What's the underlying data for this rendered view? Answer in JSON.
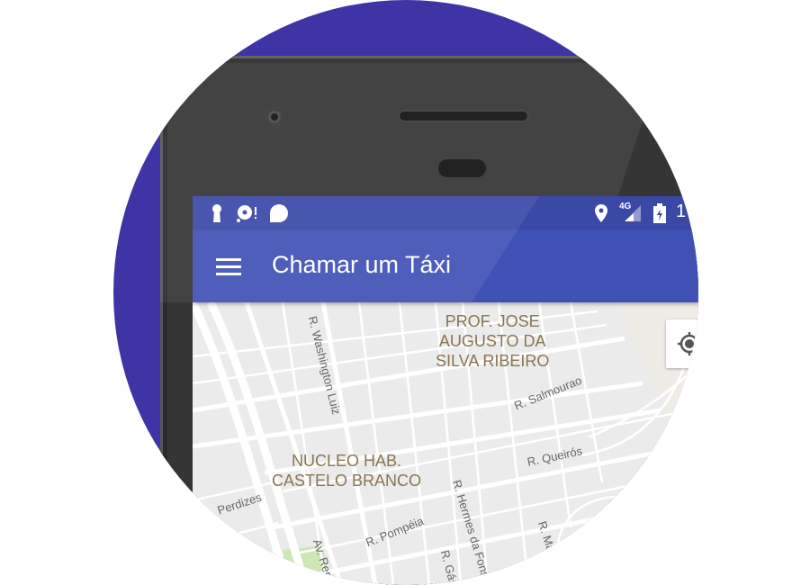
{
  "app": {
    "title": "Chamar um Táxi",
    "menu_icon": "hamburger-menu-icon"
  },
  "status_bar": {
    "left_icons": [
      "keyhole-icon",
      "media-alert-icon",
      "chat-bubble-icon"
    ],
    "right_icons": [
      "location-pin-icon",
      "signal-4g-icon",
      "battery-charging-icon"
    ],
    "network_label": "4G",
    "clock_partial": "1"
  },
  "map": {
    "areas": [
      "PROF. JOSE\nAUGUSTO DA\nSILVA RIBEIRO",
      "NUCLEO HAB.\nCASTELO BRANCO"
    ],
    "streets": [
      "R. Washington Luiz",
      "R. Salmourao",
      "R. Queirós",
      "R. Hermes da Fons",
      "R. Mar",
      "R. Pompéia",
      "R. Gás",
      "Av. Repú",
      "Perdizes"
    ],
    "locate_button_icon": "my-location-icon"
  },
  "colors": {
    "background_circle": "#3f34a5",
    "app_bar": "#3f51b5",
    "status_bar": "#3a48a6",
    "map_label": "#8a7550"
  }
}
